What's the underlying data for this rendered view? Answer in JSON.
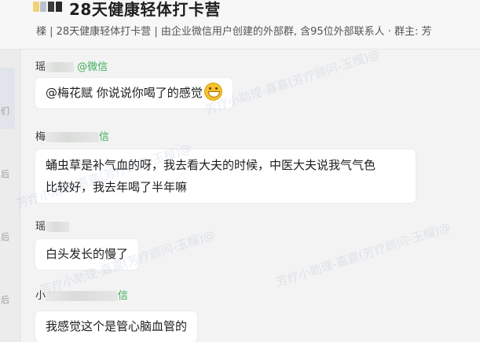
{
  "header": {
    "title": "28天健康轻体打卡营",
    "subtitle": "檪 | 28天健康轻体打卡营 | 由企业微信用户创建的外部群, 含95位外部联系人 · 群主: 芳"
  },
  "left_strip": {
    "chars": [
      "们",
      "后",
      "后",
      "后"
    ]
  },
  "messages": [
    {
      "sender_prefix": "瑶",
      "sender_tag": "@微信",
      "text": "@梅花赋 你说说你喝了的感觉",
      "emoji": "grinning-emoji"
    },
    {
      "sender_prefix": "梅",
      "sender_tag": "信",
      "lines": [
        "蛹虫草是补气血的呀，我去看大夫的时候，中医大夫说我气气色",
        "比较好，我去年喝了半年嘛"
      ]
    },
    {
      "sender_prefix": "瑶",
      "sender_tag": "",
      "text": "白头发长的慢了"
    },
    {
      "sender_prefix": "小",
      "sender_tag": "信",
      "text": "我感觉这个是管心脑血管的"
    }
  ],
  "watermark": "芳疗小助理-嘉嘉(芳疗顾问-玉榴)@"
}
